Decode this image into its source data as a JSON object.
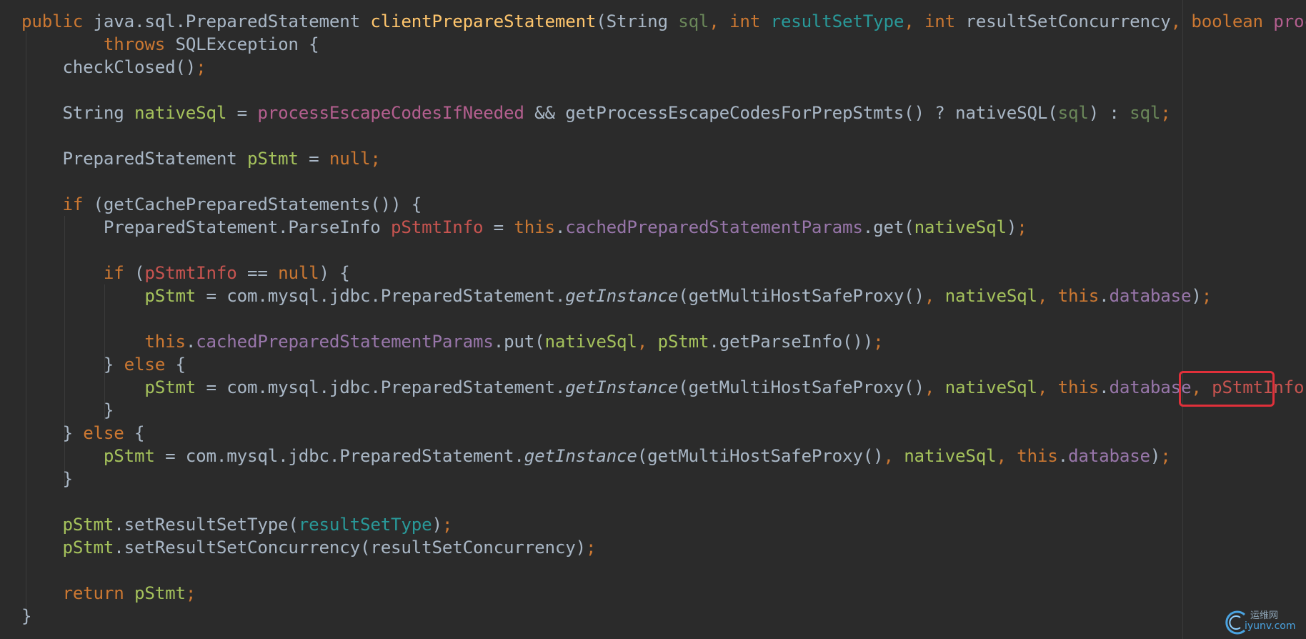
{
  "editor": {
    "lines": [
      [
        [
          "kw",
          "public "
        ],
        [
          "plain",
          "java.sql.PreparedStatement "
        ],
        [
          "fn-y",
          "clientPrepareStatement"
        ],
        [
          "plain",
          "(String "
        ],
        [
          "param",
          "sql"
        ],
        [
          "kw",
          ", int "
        ],
        [
          "param-g",
          "resultSetType"
        ],
        [
          "kw",
          ", int "
        ],
        [
          "plain",
          "resultSetConcurrency"
        ],
        [
          "kw",
          ", boolean "
        ],
        [
          "param-m",
          "process"
        ]
      ],
      [
        [
          "plain",
          "        "
        ],
        [
          "kw",
          "throws "
        ],
        [
          "plain",
          "SQLException {"
        ]
      ],
      [
        [
          "plain",
          "    checkClosed()"
        ],
        [
          "kw",
          ";"
        ]
      ],
      [
        [
          "plain",
          ""
        ]
      ],
      [
        [
          "plain",
          "    String "
        ],
        [
          "var",
          "nativeSql"
        ],
        [
          "plain",
          " = "
        ],
        [
          "param-m",
          "processEscapeCodesIfNeeded"
        ],
        [
          "plain",
          " && getProcessEscapeCodesForPrepStmts() ? nativeSQL("
        ],
        [
          "param",
          "sql"
        ],
        [
          "plain",
          ") : "
        ],
        [
          "param",
          "sql"
        ],
        [
          "kw",
          ";"
        ]
      ],
      [
        [
          "plain",
          ""
        ]
      ],
      [
        [
          "plain",
          "    PreparedStatement "
        ],
        [
          "var",
          "pStmt"
        ],
        [
          "plain",
          " = "
        ],
        [
          "kw",
          "null;"
        ]
      ],
      [
        [
          "plain",
          ""
        ]
      ],
      [
        [
          "plain",
          "    "
        ],
        [
          "kw",
          "if "
        ],
        [
          "plain",
          "(getCachePreparedStatements()) {"
        ]
      ],
      [
        [
          "plain",
          "        PreparedStatement.ParseInfo "
        ],
        [
          "param-r",
          "pStmtInfo"
        ],
        [
          "plain",
          " = "
        ],
        [
          "kw",
          "this"
        ],
        [
          "plain",
          "."
        ],
        [
          "fld",
          "cachedPreparedStatementParams"
        ],
        [
          "plain",
          ".get("
        ],
        [
          "var",
          "nativeSql"
        ],
        [
          "plain",
          ")"
        ],
        [
          "kw",
          ";"
        ]
      ],
      [
        [
          "plain",
          ""
        ]
      ],
      [
        [
          "plain",
          "        "
        ],
        [
          "kw",
          "if "
        ],
        [
          "plain",
          "("
        ],
        [
          "param-r",
          "pStmtInfo"
        ],
        [
          "plain",
          " == "
        ],
        [
          "kw",
          "null"
        ],
        [
          "plain",
          ") {"
        ]
      ],
      [
        [
          "plain",
          "            "
        ],
        [
          "var",
          "pStmt"
        ],
        [
          "plain",
          " = com.mysql.jdbc.PreparedStatement."
        ],
        [
          "ital",
          "getInstance"
        ],
        [
          "plain",
          "(getMultiHostSafeProxy()"
        ],
        [
          "kw",
          ", "
        ],
        [
          "var",
          "nativeSql"
        ],
        [
          "kw",
          ", this"
        ],
        [
          "plain",
          "."
        ],
        [
          "fld",
          "database"
        ],
        [
          "plain",
          ")"
        ],
        [
          "kw",
          ";"
        ]
      ],
      [
        [
          "plain",
          ""
        ]
      ],
      [
        [
          "plain",
          "            "
        ],
        [
          "kw",
          "this"
        ],
        [
          "plain",
          "."
        ],
        [
          "fld",
          "cachedPreparedStatementParams"
        ],
        [
          "plain",
          ".put("
        ],
        [
          "var",
          "nativeSql"
        ],
        [
          "kw",
          ", "
        ],
        [
          "var",
          "pStmt"
        ],
        [
          "plain",
          ".getParseInfo())"
        ],
        [
          "kw",
          ";"
        ]
      ],
      [
        [
          "plain",
          "        } "
        ],
        [
          "kw",
          "else "
        ],
        [
          "plain",
          "{"
        ]
      ],
      [
        [
          "plain",
          "            "
        ],
        [
          "var",
          "pStmt"
        ],
        [
          "plain",
          " = com.mysql.jdbc.PreparedStatement."
        ],
        [
          "ital",
          "getInstance"
        ],
        [
          "plain",
          "(getMultiHostSafeProxy()"
        ],
        [
          "kw",
          ", "
        ],
        [
          "var",
          "nativeSql"
        ],
        [
          "kw",
          ", this"
        ],
        [
          "plain",
          "."
        ],
        [
          "fld",
          "database"
        ],
        [
          "kw",
          ", "
        ],
        [
          "param-r",
          "pStmtInfo"
        ],
        [
          "plain",
          ")"
        ],
        [
          "kw",
          ";"
        ]
      ],
      [
        [
          "plain",
          "        }"
        ]
      ],
      [
        [
          "plain",
          "    } "
        ],
        [
          "kw",
          "else "
        ],
        [
          "plain",
          "{"
        ]
      ],
      [
        [
          "plain",
          "        "
        ],
        [
          "var",
          "pStmt"
        ],
        [
          "plain",
          " = com.mysql.jdbc.PreparedStatement."
        ],
        [
          "ital",
          "getInstance"
        ],
        [
          "plain",
          "(getMultiHostSafeProxy()"
        ],
        [
          "kw",
          ", "
        ],
        [
          "var",
          "nativeSql"
        ],
        [
          "kw",
          ", this"
        ],
        [
          "plain",
          "."
        ],
        [
          "fld",
          "database"
        ],
        [
          "plain",
          ")"
        ],
        [
          "kw",
          ";"
        ]
      ],
      [
        [
          "plain",
          "    }"
        ]
      ],
      [
        [
          "plain",
          ""
        ]
      ],
      [
        [
          "plain",
          "    "
        ],
        [
          "var",
          "pStmt"
        ],
        [
          "plain",
          ".setResultSetType("
        ],
        [
          "param-g",
          "resultSetType"
        ],
        [
          "plain",
          ")"
        ],
        [
          "kw",
          ";"
        ]
      ],
      [
        [
          "plain",
          "    "
        ],
        [
          "var",
          "pStmt"
        ],
        [
          "plain",
          ".setResultSetConcurrency("
        ],
        [
          "plain",
          "resultSetConcurrency"
        ],
        [
          "plain",
          ")"
        ],
        [
          "kw",
          ";"
        ]
      ],
      [
        [
          "plain",
          ""
        ]
      ],
      [
        [
          "plain",
          "    "
        ],
        [
          "kw",
          "return "
        ],
        [
          "var",
          "pStmt"
        ],
        [
          "kw",
          ";"
        ]
      ],
      [
        [
          "plain",
          "}"
        ]
      ]
    ]
  },
  "watermark": {
    "cn": "运维网",
    "en": "iyunv.com"
  }
}
